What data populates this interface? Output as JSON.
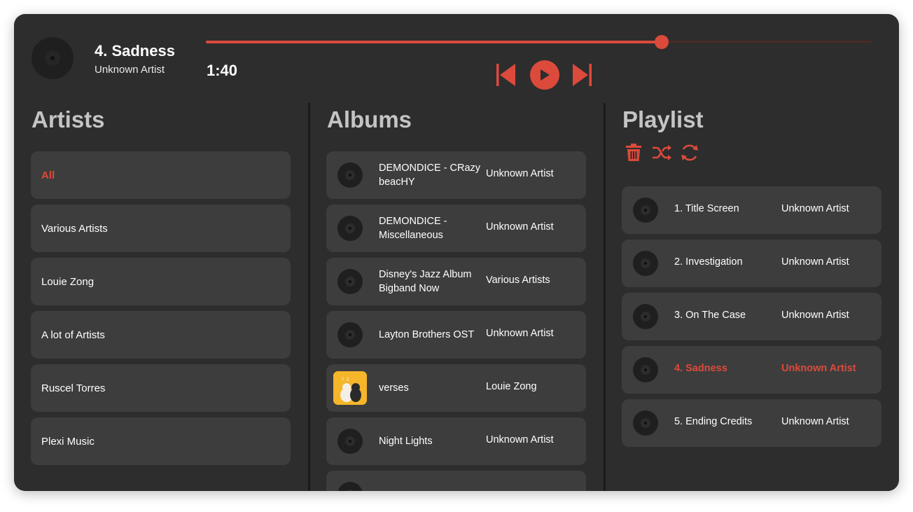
{
  "now_playing": {
    "title": "4. Sadness",
    "artist": "Unknown Artist",
    "time": "1:40",
    "progress": 0.685,
    "icon": "vinyl-disc-icon"
  },
  "controls": {
    "previous_icon": "skip-previous-icon",
    "play_icon": "play-icon",
    "next_icon": "skip-next-icon"
  },
  "colors": {
    "accent": "#dc4a3b",
    "background": "#2d2d2d",
    "card": "#3d3d3d",
    "heading": "#c4c4c4"
  },
  "artists": {
    "heading": "Artists",
    "items": [
      {
        "label": "All",
        "active": true
      },
      {
        "label": "Various Artists"
      },
      {
        "label": "Louie Zong"
      },
      {
        "label": "A lot of Artists"
      },
      {
        "label": "Ruscel Torres"
      },
      {
        "label": "Plexi Music"
      }
    ]
  },
  "albums": {
    "heading": "Albums",
    "items": [
      {
        "name": "DEMONDICE - CRazy beacHY",
        "artist": "Unknown Artist"
      },
      {
        "name": "DEMONDICE - Miscellaneous",
        "artist": "Unknown Artist"
      },
      {
        "name": "Disney's Jazz Album Bigband Now",
        "artist": "Various Artists"
      },
      {
        "name": "Layton Brothers OST",
        "artist": "Unknown Artist"
      },
      {
        "name": "verses",
        "artist": "Louie Zong",
        "cover": "album-cover-art"
      },
      {
        "name": "Night Lights",
        "artist": "Unknown Artist"
      }
    ]
  },
  "playlist": {
    "heading": "Playlist",
    "icons": [
      "trash-icon",
      "shuffle-icon",
      "repeat-icon"
    ],
    "items": [
      {
        "name": "1. Title Screen",
        "artist": "Unknown Artist"
      },
      {
        "name": "2. Investigation",
        "artist": "Unknown Artist"
      },
      {
        "name": "3. On The Case",
        "artist": "Unknown Artist"
      },
      {
        "name": "4. Sadness",
        "artist": "Unknown Artist",
        "active": true
      },
      {
        "name": "5. Ending Credits",
        "artist": "Unknown Artist"
      }
    ]
  }
}
